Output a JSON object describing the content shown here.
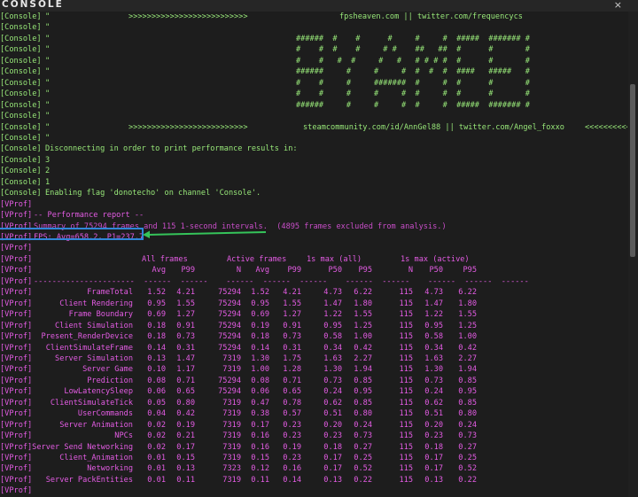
{
  "window": {
    "title": "CONSOLE",
    "close_label": "×"
  },
  "colors": {
    "console_text": "#98e879",
    "vprof_text": "#e45ce4",
    "highlight_box": "#2f86d8",
    "arrow": "#35c45a"
  },
  "console_lines": [
    {
      "prefix": "[Console]",
      "left": "\"",
      "mid": ">>>>>>>>>>>>>>>>>>>>>>>>>>",
      "right": "fpsheaven.com || twitter.com/frequencycs"
    },
    {
      "prefix": "[Console]",
      "left": "\"",
      "mid": "",
      "right": ""
    },
    {
      "prefix": "[Console]",
      "left": "\"",
      "mid": "",
      "right": "######  #    #      #     #     #  #####  ####### #"
    },
    {
      "prefix": "[Console]",
      "left": "\"",
      "mid": "",
      "right": "#    #  #    #     # #    ##   ##  #      #       #"
    },
    {
      "prefix": "[Console]",
      "left": "\"",
      "mid": "",
      "right": "#    #   #  #     #   #   # # # #  #      #       #"
    },
    {
      "prefix": "[Console]",
      "left": "\"",
      "mid": "",
      "right": "######     #     #     #  #  #  #  ####   #####   #"
    },
    {
      "prefix": "[Console]",
      "left": "\"",
      "mid": "",
      "right": "#    #     #     #######  #     #  #      #       #"
    },
    {
      "prefix": "[Console]",
      "left": "\"",
      "mid": "",
      "right": "#    #     #     #     #  #     #  #      #       #"
    },
    {
      "prefix": "[Console]",
      "left": "\"",
      "mid": "",
      "right": "######     #     #     #  #     #  #####  ####### #"
    },
    {
      "prefix": "[Console]",
      "left": "\"",
      "mid": "",
      "right": ""
    },
    {
      "prefix": "[Console]",
      "left": "\"",
      "mid": ">>>>>>>>>>>>>>>>>>>>>>>>>>",
      "right": "steamcommunity.com/id/AnnGel88 || twitter.com/Angel_foxxo",
      "tail": "<<<<<<<<<<"
    },
    {
      "prefix": "[Console]",
      "left": "\"",
      "mid": "",
      "right": ""
    },
    {
      "prefix": "[Console]",
      "left": "Disconnecting in order to print performance results in:",
      "mid": "",
      "right": ""
    },
    {
      "prefix": "[Console]",
      "left": "3",
      "mid": "",
      "right": ""
    },
    {
      "prefix": "[Console]",
      "left": "2",
      "mid": "",
      "right": ""
    },
    {
      "prefix": "[Console]",
      "left": "1",
      "mid": "",
      "right": ""
    },
    {
      "prefix": "[Console]",
      "left": "Enabling flag 'donotecho' on channel 'Console'.",
      "mid": "",
      "right": ""
    }
  ],
  "vprof_header": [
    {
      "prefix": "[VProf]",
      "text": ""
    },
    {
      "prefix": "[VProf]",
      "text": "-- Performance report --"
    },
    {
      "prefix": "[VProf]",
      "text": "Summary of 75294 frames and 115 1-second intervals.  (4895 frames excluded from analysis.)"
    },
    {
      "prefix": "[VProf]",
      "text": "FPS: Avg=658.2, P1=237.7"
    },
    {
      "prefix": "[VProf]",
      "text": ""
    }
  ],
  "table": {
    "groups": [
      "All frames",
      "Active frames",
      "1s max (all)",
      "1s max (active)"
    ],
    "columns": [
      "Avg",
      "P99",
      "N",
      "Avg",
      "P99",
      "P50",
      "P95",
      "N",
      "P50",
      "P95"
    ],
    "separator": "----------------------  ------  ------    ------  ------  ------    ------  ------    ------  ------  ------",
    "rows": [
      {
        "name": "FrameTotal",
        "v": [
          "1.52",
          "4.21",
          "75294",
          "1.52",
          "4.21",
          "4.73",
          "6.22",
          "115",
          "4.73",
          "6.22"
        ]
      },
      {
        "name": "Client Rendering",
        "v": [
          "0.95",
          "1.55",
          "75294",
          "0.95",
          "1.55",
          "1.47",
          "1.80",
          "115",
          "1.47",
          "1.80"
        ]
      },
      {
        "name": "Frame Boundary",
        "v": [
          "0.69",
          "1.27",
          "75294",
          "0.69",
          "1.27",
          "1.22",
          "1.55",
          "115",
          "1.22",
          "1.55"
        ]
      },
      {
        "name": "Client Simulation",
        "v": [
          "0.18",
          "0.91",
          "75294",
          "0.19",
          "0.91",
          "0.95",
          "1.25",
          "115",
          "0.95",
          "1.25"
        ]
      },
      {
        "name": "Present_RenderDevice",
        "v": [
          "0.18",
          "0.73",
          "75294",
          "0.18",
          "0.73",
          "0.58",
          "1.00",
          "115",
          "0.58",
          "1.00"
        ]
      },
      {
        "name": "ClientSimulateFrame",
        "v": [
          "0.14",
          "0.31",
          "75294",
          "0.14",
          "0.31",
          "0.34",
          "0.42",
          "115",
          "0.34",
          "0.42"
        ]
      },
      {
        "name": "Server Simulation",
        "v": [
          "0.13",
          "1.47",
          "7319",
          "1.30",
          "1.75",
          "1.63",
          "2.27",
          "115",
          "1.63",
          "2.27"
        ]
      },
      {
        "name": "Server Game",
        "v": [
          "0.10",
          "1.17",
          "7319",
          "1.00",
          "1.28",
          "1.30",
          "1.94",
          "115",
          "1.30",
          "1.94"
        ]
      },
      {
        "name": "Prediction",
        "v": [
          "0.08",
          "0.71",
          "75294",
          "0.08",
          "0.71",
          "0.73",
          "0.85",
          "115",
          "0.73",
          "0.85"
        ]
      },
      {
        "name": "LowLatencySleep",
        "v": [
          "0.06",
          "0.65",
          "75294",
          "0.06",
          "0.65",
          "0.24",
          "0.95",
          "115",
          "0.24",
          "0.95"
        ]
      },
      {
        "name": "ClientSimulateTick",
        "v": [
          "0.05",
          "0.80",
          "7319",
          "0.47",
          "0.78",
          "0.62",
          "0.85",
          "115",
          "0.62",
          "0.85"
        ]
      },
      {
        "name": "UserCommands",
        "v": [
          "0.04",
          "0.42",
          "7319",
          "0.38",
          "0.57",
          "0.51",
          "0.80",
          "115",
          "0.51",
          "0.80"
        ]
      },
      {
        "name": "Server Animation",
        "v": [
          "0.02",
          "0.19",
          "7319",
          "0.17",
          "0.23",
          "0.20",
          "0.24",
          "115",
          "0.20",
          "0.24"
        ]
      },
      {
        "name": "NPCs",
        "v": [
          "0.02",
          "0.21",
          "7319",
          "0.16",
          "0.23",
          "0.23",
          "0.73",
          "115",
          "0.23",
          "0.73"
        ]
      },
      {
        "name": "Server Send Networking",
        "v": [
          "0.02",
          "0.17",
          "7319",
          "0.16",
          "0.19",
          "0.18",
          "0.27",
          "115",
          "0.18",
          "0.27"
        ]
      },
      {
        "name": "Client_Animation",
        "v": [
          "0.01",
          "0.15",
          "7319",
          "0.15",
          "0.23",
          "0.17",
          "0.25",
          "115",
          "0.17",
          "0.25"
        ]
      },
      {
        "name": "Networking",
        "v": [
          "0.01",
          "0.13",
          "7323",
          "0.12",
          "0.16",
          "0.17",
          "0.52",
          "115",
          "0.17",
          "0.52"
        ]
      },
      {
        "name": "Server PackEntities",
        "v": [
          "0.01",
          "0.11",
          "7319",
          "0.11",
          "0.14",
          "0.13",
          "0.22",
          "115",
          "0.13",
          "0.22"
        ]
      }
    ],
    "trailing_prefix": "[VProf]"
  }
}
